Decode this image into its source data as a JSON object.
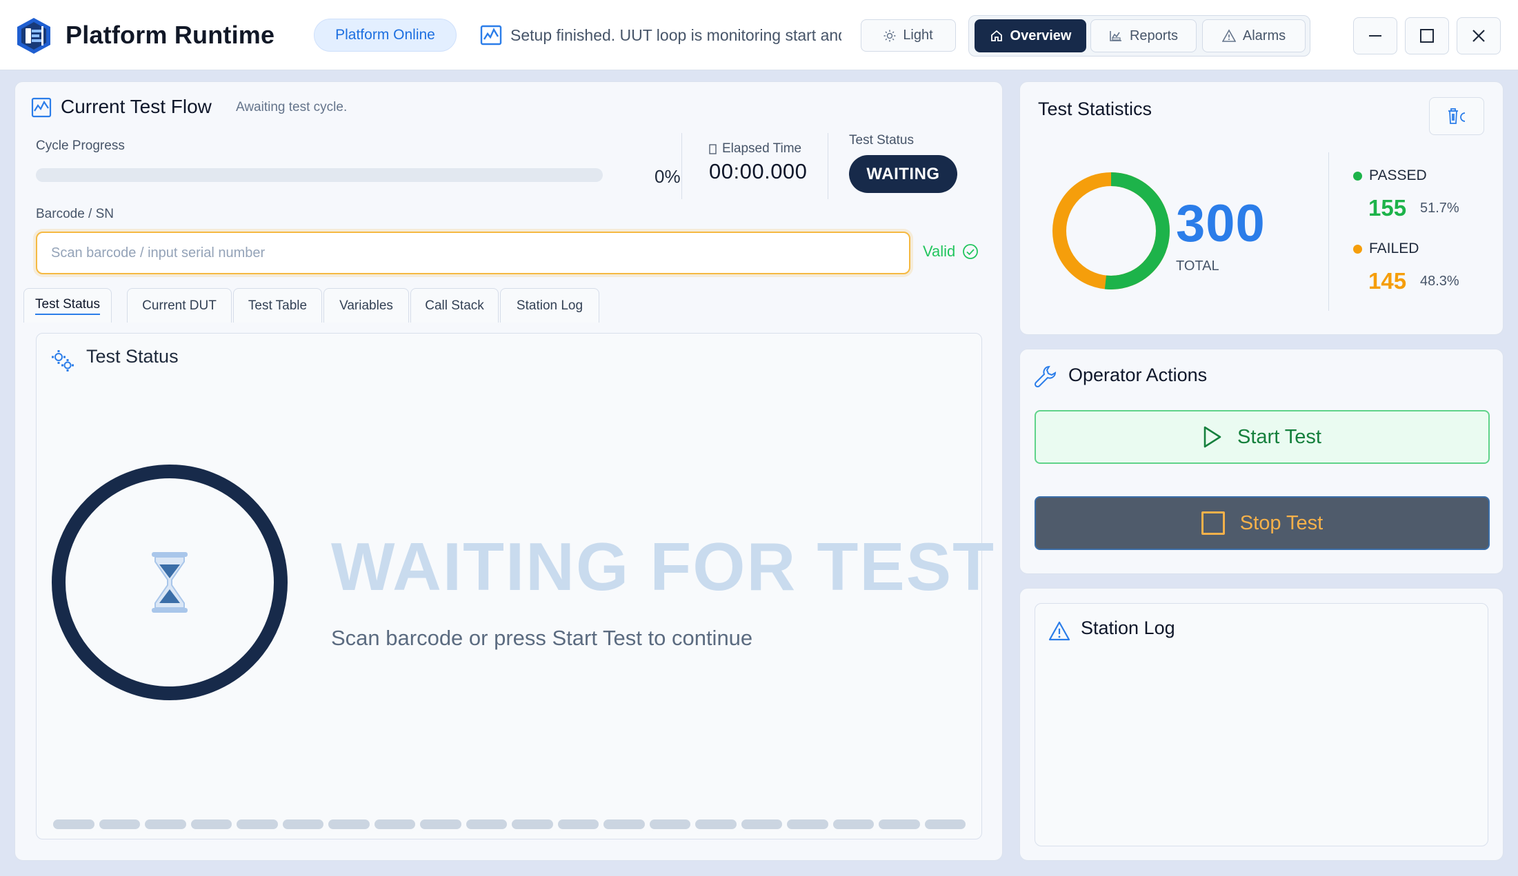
{
  "header": {
    "app_title": "Platform Runtime",
    "online_label": "Platform Online",
    "status_message": "Setup finished. UUT loop is monitoring start and",
    "theme_label": "Light",
    "nav": [
      {
        "label": "Overview",
        "icon": "home-icon",
        "active": true
      },
      {
        "label": "Reports",
        "icon": "chart-icon",
        "active": false
      },
      {
        "label": "Alarms",
        "icon": "warning-icon",
        "active": false
      }
    ]
  },
  "flow": {
    "title": "Current Test Flow",
    "subtitle": "Awaiting test cycle.",
    "cycle_progress_label": "Cycle Progress",
    "cycle_progress_percent": "0%",
    "cycle_progress_value": 0,
    "elapsed_label": "Elapsed Time",
    "elapsed_value": "00:00.000",
    "test_status_label": "Test Status",
    "test_status_value": "WAITING",
    "barcode_label": "Barcode / SN",
    "barcode_placeholder": "Scan barcode / input serial number",
    "barcode_value": "",
    "valid_label": "Valid",
    "tabs": [
      "Test Status",
      "Current DUT",
      "Test Table",
      "Variables",
      "Call Stack",
      "Station Log"
    ],
    "active_tab": "Test Status",
    "card_title": "Test Status",
    "waiting_title": "WAITING FOR TEST",
    "waiting_sub": "Scan barcode or press Start Test to continue"
  },
  "stats": {
    "title": "Test Statistics",
    "total": "300",
    "total_label": "TOTAL",
    "passed_label": "PASSED",
    "passed_count": "155",
    "passed_pct": "51.7%",
    "failed_label": "FAILED",
    "failed_count": "145",
    "failed_pct": "48.3%",
    "passed_fraction": 0.517,
    "colors": {
      "passed": "#1db34a",
      "failed": "#f59e0b",
      "total": "#2b7de9"
    }
  },
  "ops": {
    "title": "Operator Actions",
    "start_label": "Start Test",
    "stop_label": "Stop Test"
  },
  "log": {
    "title": "Station Log"
  },
  "colors": {
    "accent": "#2b7de9",
    "dark_navy": "#172a4a",
    "warning_border": "#f5b942",
    "valid_green": "#22c55e"
  }
}
